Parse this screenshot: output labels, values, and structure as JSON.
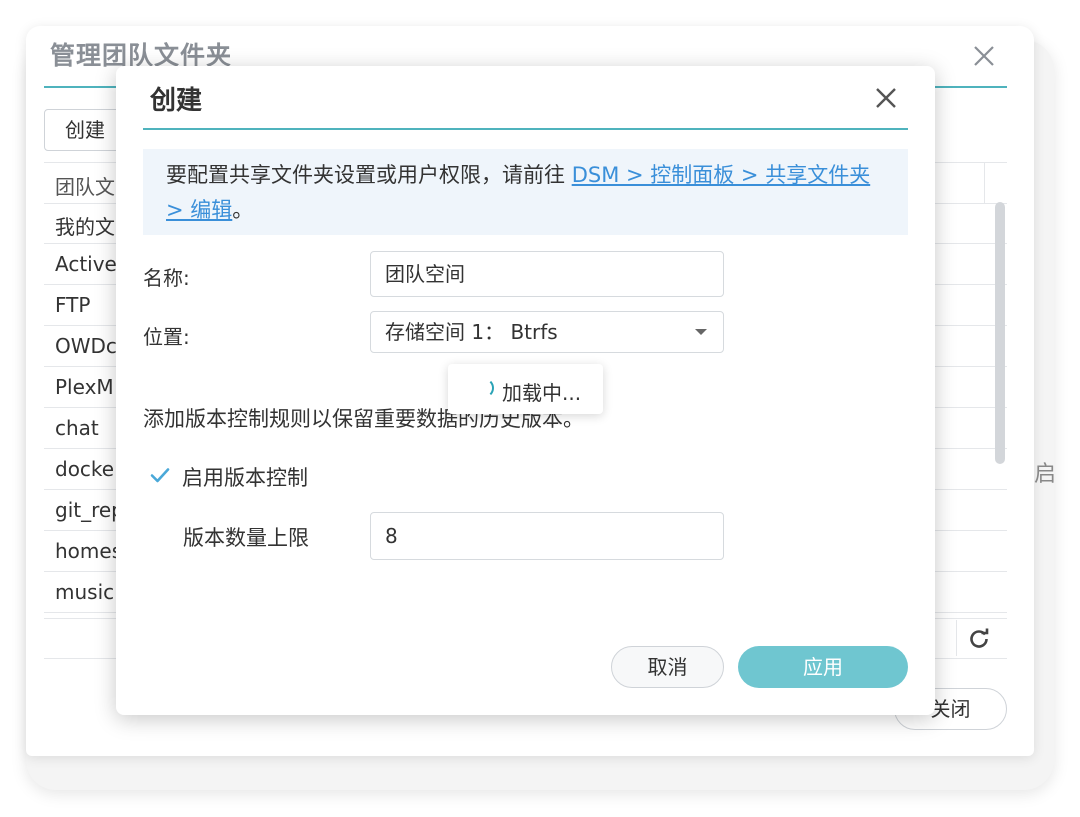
{
  "outer": {
    "title": "管理团队文件夹",
    "create_label": "创建",
    "column_header": "团队文",
    "rows": [
      "我的文",
      "Active",
      "FTP",
      "OWDc",
      "PlexM",
      "chat",
      "docke",
      "git_rep",
      "homes",
      "music"
    ],
    "partial_text": "启",
    "close_label": "关闭"
  },
  "modal": {
    "title": "创建",
    "info_prefix": "要配置共享文件夹设置或用户权限，请前往 ",
    "info_link": "DSM > 控制面板 > 共享文件夹 > 编辑",
    "info_suffix": "。",
    "name_label": "名称:",
    "name_value": "团队空间",
    "location_label": "位置:",
    "location_value": "存储空间 1： Btrfs",
    "loading_text": "加载中...",
    "version_note": "添加版本控制规则以保留重要数据的历史版本。",
    "enable_version_label": "启用版本控制",
    "enable_version_checked": true,
    "version_limit_label": "版本数量上限",
    "version_limit_value": "8",
    "cancel_label": "取消",
    "apply_label": "应用"
  },
  "colors": {
    "accent": "#4fb3bd",
    "apply_button": "#6fc6d0",
    "link": "#3a8fd9",
    "info_bg": "#eff5fb"
  }
}
